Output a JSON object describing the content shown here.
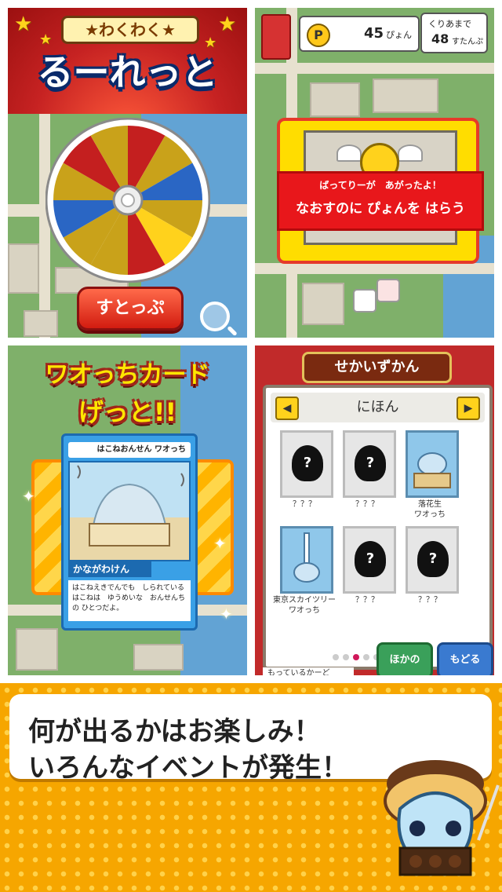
{
  "panel1": {
    "subtitle": "★わくわく★",
    "title": "るーれっと",
    "stop_button": "すとっぷ"
  },
  "panel2": {
    "points_icon": "P",
    "points_value": "45",
    "points_unit": "ぴょん",
    "moves_label": "くりあまで",
    "moves_value": "48",
    "moves_unit": "すたんぷ",
    "event_line1": "ばってりーが　あがったよ！",
    "event_line2": "なおすのに ぴょんを はらう"
  },
  "panel3": {
    "title_line1": "ワオっちカード",
    "title_line2": "げっと!!",
    "card": {
      "header": "はこねおんせん ワオっち",
      "name": "かながわけん",
      "description": "はこねえきでんでも　しられている はこねは　ゆうめいな　おんせんちの ひとつだよ。"
    }
  },
  "panel4": {
    "tab_title": "せかいずかん",
    "region": "にほん",
    "prev_icon": "◀",
    "next_icon": "▶",
    "slots": [
      {
        "label": "？？？",
        "known": false
      },
      {
        "label": "？？？",
        "known": false
      },
      {
        "label": "落花生\nワオっち",
        "known": true
      },
      {
        "label": "東京スカイツリー\nワオっち",
        "known": true
      },
      {
        "label": "？？？",
        "known": false
      },
      {
        "label": "？？？",
        "known": false
      }
    ],
    "other_button": "ほかの",
    "back_button": "もどる",
    "bottom_tab": "もっているかーど"
  },
  "banner": {
    "line1": "何が出るかはお楽しみ！",
    "line2": "いろんなイベントが発生！"
  },
  "colors": {
    "accent_red": "#c62222",
    "banner_orange": "#f6a600",
    "card_blue": "#3aa0e6"
  }
}
